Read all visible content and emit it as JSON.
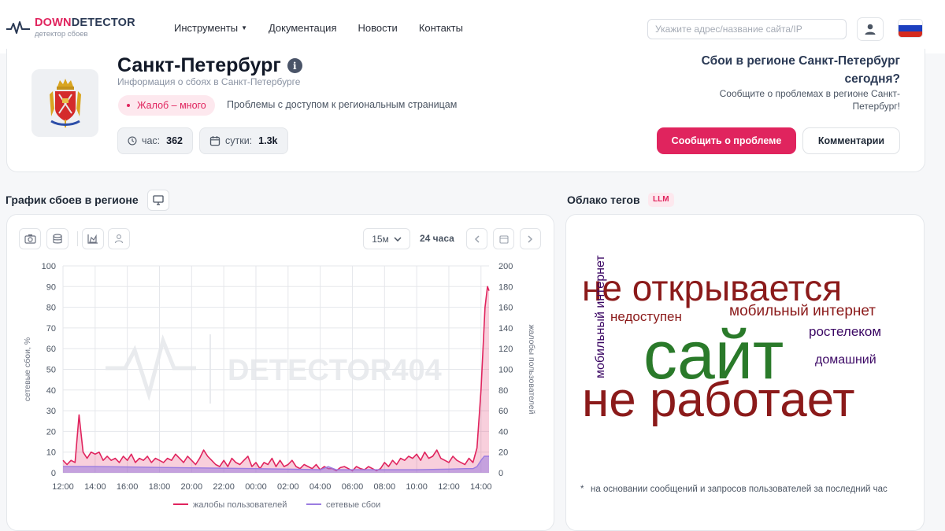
{
  "header": {
    "logo_part1": "DOWN",
    "logo_part2": "DETECTOR",
    "logo_sub": "детектор сбоев",
    "nav": [
      {
        "label": "Инструменты",
        "dropdown": true
      },
      {
        "label": "Документация"
      },
      {
        "label": "Новости"
      },
      {
        "label": "Контакты"
      }
    ],
    "search_placeholder": "Укажите адрес/название сайта/IP",
    "user_icon": "user-icon",
    "flag_icon": "russia-flag-icon"
  },
  "region": {
    "city": "Санкт-Петербург",
    "subtitle": "Информация о сбоях в Санкт-Петербурге",
    "badge": "Жалоб – много",
    "badge_note": "Проблемы с доступом к региональным страницам",
    "stat_hour_label": "час:",
    "stat_hour_value": "362",
    "stat_day_label": "сутки:",
    "stat_day_value": "1.3k",
    "question": "Сбои в регионе Санкт-Петербург сегодня?",
    "question_sub": "Сообщите о проблемах в регионе Санкт-Петербург!",
    "report_button": "Сообщить о проблеме",
    "comments_button": "Комментарии"
  },
  "chart_section": {
    "title": "График сбоев в регионе",
    "interval": "15м",
    "range": "24 часа",
    "tools": [
      "camera-icon",
      "database-icon",
      "chart-area-icon",
      "user-icon"
    ]
  },
  "tags_section": {
    "title": "Облако тегов",
    "badge": "LLM",
    "tags": [
      {
        "text": "не открывается",
        "color": "#8b1a1a"
      },
      {
        "text": "мобильный интернет",
        "color": "#8b1a1a"
      },
      {
        "text": "недоступен",
        "color": "#8b1a1a"
      },
      {
        "text": "мобильный интернет",
        "color": "#3b0764",
        "vertical": true
      },
      {
        "text": "ростелеком",
        "color": "#3b0764"
      },
      {
        "text": "сайт",
        "color": "#2a7a2a"
      },
      {
        "text": "домашний",
        "color": "#3b0764"
      },
      {
        "text": "не работает",
        "color": "#8b1a1a"
      }
    ],
    "note": "на основании сообщений и запросов пользователей за последний час"
  },
  "colors": {
    "accent": "#e0245e",
    "complaints_line": "#e0245e",
    "failures_line": "#9b7ce0",
    "navy": "#2b3a55"
  },
  "chart_data": {
    "type": "area",
    "x_ticks": [
      "12:00",
      "14:00",
      "16:00",
      "18:00",
      "20:00",
      "22:00",
      "00:00",
      "02:00",
      "04:00",
      "06:00",
      "08:00",
      "10:00",
      "12:00",
      "14:00"
    ],
    "ylabel_left": "сетевые сбои, %",
    "ylabel_right": "жалобы пользователей",
    "ylim_left": [
      0,
      100
    ],
    "ylim_right": [
      0,
      200
    ],
    "left_ticks": [
      0,
      10,
      20,
      30,
      40,
      50,
      60,
      70,
      80,
      90,
      100
    ],
    "right_ticks": [
      0,
      20,
      40,
      60,
      80,
      100,
      120,
      140,
      160,
      180,
      200
    ],
    "watermark": "DETECTOR404",
    "grid": true,
    "legend": "bottom",
    "series": [
      {
        "name": "жалобы пользователей",
        "axis": "left",
        "points": [
          [
            12,
            6
          ],
          [
            12.25,
            4
          ],
          [
            12.5,
            6
          ],
          [
            12.75,
            5
          ],
          [
            13,
            28
          ],
          [
            13.25,
            10
          ],
          [
            13.5,
            7
          ],
          [
            13.75,
            10
          ],
          [
            14,
            9
          ],
          [
            14.25,
            10
          ],
          [
            14.5,
            6
          ],
          [
            14.75,
            8
          ],
          [
            15,
            6
          ],
          [
            15.25,
            7
          ],
          [
            15.5,
            5
          ],
          [
            15.75,
            8
          ],
          [
            16,
            6
          ],
          [
            16.25,
            9
          ],
          [
            16.5,
            5
          ],
          [
            16.75,
            7
          ],
          [
            17,
            6
          ],
          [
            17.25,
            8
          ],
          [
            17.5,
            5
          ],
          [
            17.75,
            7
          ],
          [
            18,
            6
          ],
          [
            18.25,
            5
          ],
          [
            18.5,
            7
          ],
          [
            18.75,
            6
          ],
          [
            19,
            9
          ],
          [
            19.25,
            7
          ],
          [
            19.5,
            5
          ],
          [
            19.75,
            8
          ],
          [
            20,
            6
          ],
          [
            20.25,
            4
          ],
          [
            20.5,
            7
          ],
          [
            20.75,
            11
          ],
          [
            21,
            8
          ],
          [
            21.25,
            6
          ],
          [
            21.5,
            4
          ],
          [
            21.75,
            3
          ],
          [
            22,
            6
          ],
          [
            22.25,
            3
          ],
          [
            22.5,
            7
          ],
          [
            22.75,
            5
          ],
          [
            23,
            4
          ],
          [
            23.25,
            6
          ],
          [
            23.5,
            8
          ],
          [
            23.75,
            3
          ],
          [
            24,
            5
          ],
          [
            24.25,
            2
          ],
          [
            24.5,
            5
          ],
          [
            24.75,
            4
          ],
          [
            25,
            7
          ],
          [
            25.25,
            3
          ],
          [
            25.5,
            6
          ],
          [
            25.75,
            3
          ],
          [
            26,
            4
          ],
          [
            26.25,
            6
          ],
          [
            26.5,
            3
          ],
          [
            26.75,
            2
          ],
          [
            27,
            4
          ],
          [
            27.25,
            3
          ],
          [
            27.5,
            2
          ],
          [
            27.75,
            4
          ],
          [
            28,
            1.5
          ],
          [
            28.25,
            3
          ],
          [
            28.5,
            2
          ],
          [
            28.75,
            2
          ],
          [
            29,
            1
          ],
          [
            29.25,
            2.5
          ],
          [
            29.5,
            3
          ],
          [
            29.75,
            2
          ],
          [
            30,
            1
          ],
          [
            30.25,
            3
          ],
          [
            30.5,
            2
          ],
          [
            30.75,
            1.5
          ],
          [
            31,
            3
          ],
          [
            31.25,
            2
          ],
          [
            31.5,
            1
          ],
          [
            31.75,
            2
          ],
          [
            32,
            5
          ],
          [
            32.25,
            3
          ],
          [
            32.5,
            6
          ],
          [
            32.75,
            4
          ],
          [
            33,
            7
          ],
          [
            33.25,
            6
          ],
          [
            33.5,
            8
          ],
          [
            33.75,
            7
          ],
          [
            34,
            9
          ],
          [
            34.25,
            6
          ],
          [
            34.5,
            10
          ],
          [
            34.75,
            7
          ],
          [
            35,
            8
          ],
          [
            35.25,
            11
          ],
          [
            35.5,
            7
          ],
          [
            35.75,
            6
          ],
          [
            36,
            5
          ],
          [
            36.25,
            8
          ],
          [
            36.5,
            6
          ],
          [
            36.75,
            5
          ],
          [
            37,
            4
          ],
          [
            37.25,
            7
          ],
          [
            37.5,
            5
          ],
          [
            37.75,
            12
          ],
          [
            38,
            40
          ],
          [
            38.25,
            80
          ],
          [
            38.4,
            90
          ],
          [
            38.5,
            88
          ]
        ]
      },
      {
        "name": "сетевые сбои",
        "axis": "left",
        "points": [
          [
            12,
            3
          ],
          [
            14,
            3
          ],
          [
            16,
            2.8
          ],
          [
            18,
            2.6
          ],
          [
            20,
            2.4
          ],
          [
            22,
            2.2
          ],
          [
            24,
            2
          ],
          [
            26,
            1.8
          ],
          [
            28,
            1.5
          ],
          [
            28.5,
            3
          ],
          [
            29,
            1.5
          ],
          [
            30,
            1.5
          ],
          [
            32,
            1.5
          ],
          [
            34,
            1.5
          ],
          [
            36,
            1.8
          ],
          [
            37,
            2
          ],
          [
            37.5,
            2
          ],
          [
            37.75,
            3
          ],
          [
            38,
            6
          ],
          [
            38.2,
            8
          ],
          [
            38.5,
            8
          ]
        ]
      }
    ]
  }
}
